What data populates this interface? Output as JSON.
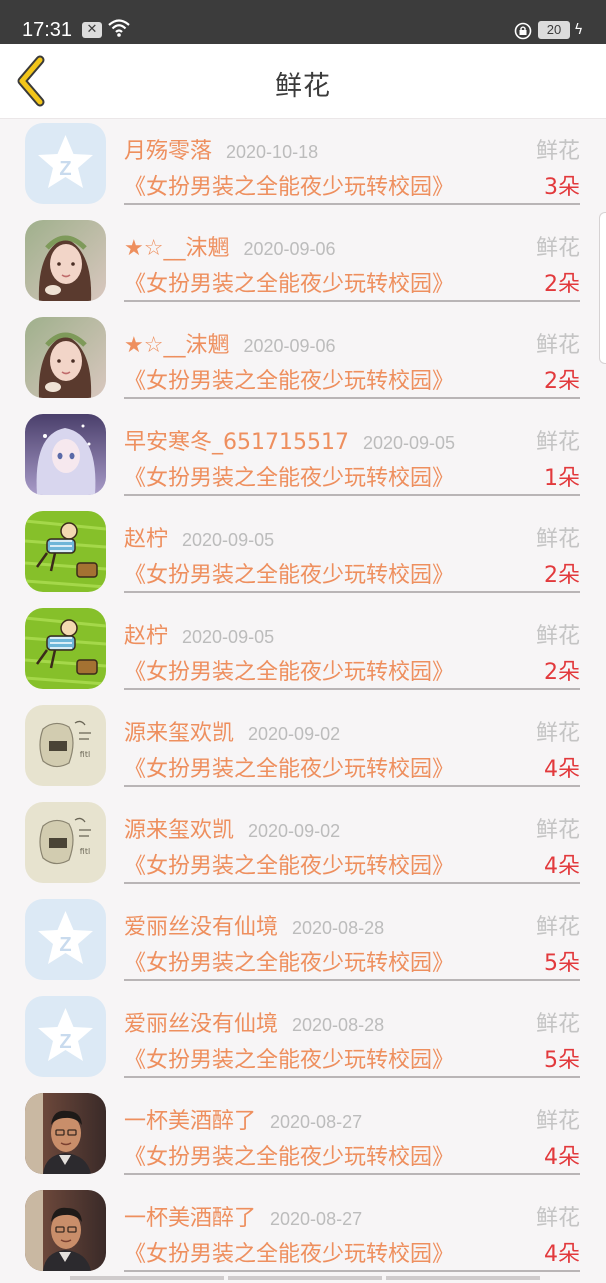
{
  "status_bar": {
    "time": "17:31",
    "notification_icon": "x-box-icon",
    "wifi_icon": "wifi-icon",
    "lock_icon": "rotation-lock-icon",
    "battery_level": "20",
    "charging_icon": "bolt-icon"
  },
  "header": {
    "back_icon": "chevron-left-icon",
    "title": "鲜花"
  },
  "colors": {
    "accent": "#ee8f5e",
    "count_red": "#e2393c",
    "back_yellow": "#f2c51a",
    "muted": "#bcbcbc"
  },
  "records": [
    {
      "user": "月殇零落",
      "date": "2020-10-18",
      "gift": "鲜花",
      "book": "《女扮男装之全能夜少玩转校园》",
      "count": "3朵",
      "avatar": "default-qq-avatar"
    },
    {
      "user": "★☆__沫魍",
      "date": "2020-09-06",
      "gift": "鲜花",
      "book": "《女扮男装之全能夜少玩转校园》",
      "count": "2朵",
      "avatar": "girl-photo-avatar"
    },
    {
      "user": "★☆__沫魍",
      "date": "2020-09-06",
      "gift": "鲜花",
      "book": "《女扮男装之全能夜少玩转校园》",
      "count": "2朵",
      "avatar": "girl-photo-avatar"
    },
    {
      "user": "早安寒冬_651715517",
      "date": "2020-09-05",
      "gift": "鲜花",
      "book": "《女扮男装之全能夜少玩转校园》",
      "count": "1朵",
      "avatar": "anime-girl-avatar"
    },
    {
      "user": "赵柠",
      "date": "2020-09-05",
      "gift": "鲜花",
      "book": "《女扮男装之全能夜少玩转校园》",
      "count": "2朵",
      "avatar": "cartoon-boy-grass-avatar"
    },
    {
      "user": "赵柠",
      "date": "2020-09-05",
      "gift": "鲜花",
      "book": "《女扮男装之全能夜少玩转校园》",
      "count": "2朵",
      "avatar": "cartoon-boy-grass-avatar"
    },
    {
      "user": "源来玺欢凯",
      "date": "2020-09-02",
      "gift": "鲜花",
      "book": "《女扮男装之全能夜少玩转校园》",
      "count": "4朵",
      "avatar": "sketch-avatar"
    },
    {
      "user": "源来玺欢凯",
      "date": "2020-09-02",
      "gift": "鲜花",
      "book": "《女扮男装之全能夜少玩转校园》",
      "count": "4朵",
      "avatar": "sketch-avatar"
    },
    {
      "user": "爱丽丝没有仙境",
      "date": "2020-08-28",
      "gift": "鲜花",
      "book": "《女扮男装之全能夜少玩转校园》",
      "count": "5朵",
      "avatar": "default-qq-avatar"
    },
    {
      "user": "爱丽丝没有仙境",
      "date": "2020-08-28",
      "gift": "鲜花",
      "book": "《女扮男装之全能夜少玩转校园》",
      "count": "5朵",
      "avatar": "default-qq-avatar"
    },
    {
      "user": "一杯美酒醉了",
      "date": "2020-08-27",
      "gift": "鲜花",
      "book": "《女扮男装之全能夜少玩转校园》",
      "count": "4朵",
      "avatar": "man-photo-avatar"
    },
    {
      "user": "一杯美酒醉了",
      "date": "2020-08-27",
      "gift": "鲜花",
      "book": "《女扮男装之全能夜少玩转校园》",
      "count": "4朵",
      "avatar": "man-photo-avatar"
    }
  ]
}
